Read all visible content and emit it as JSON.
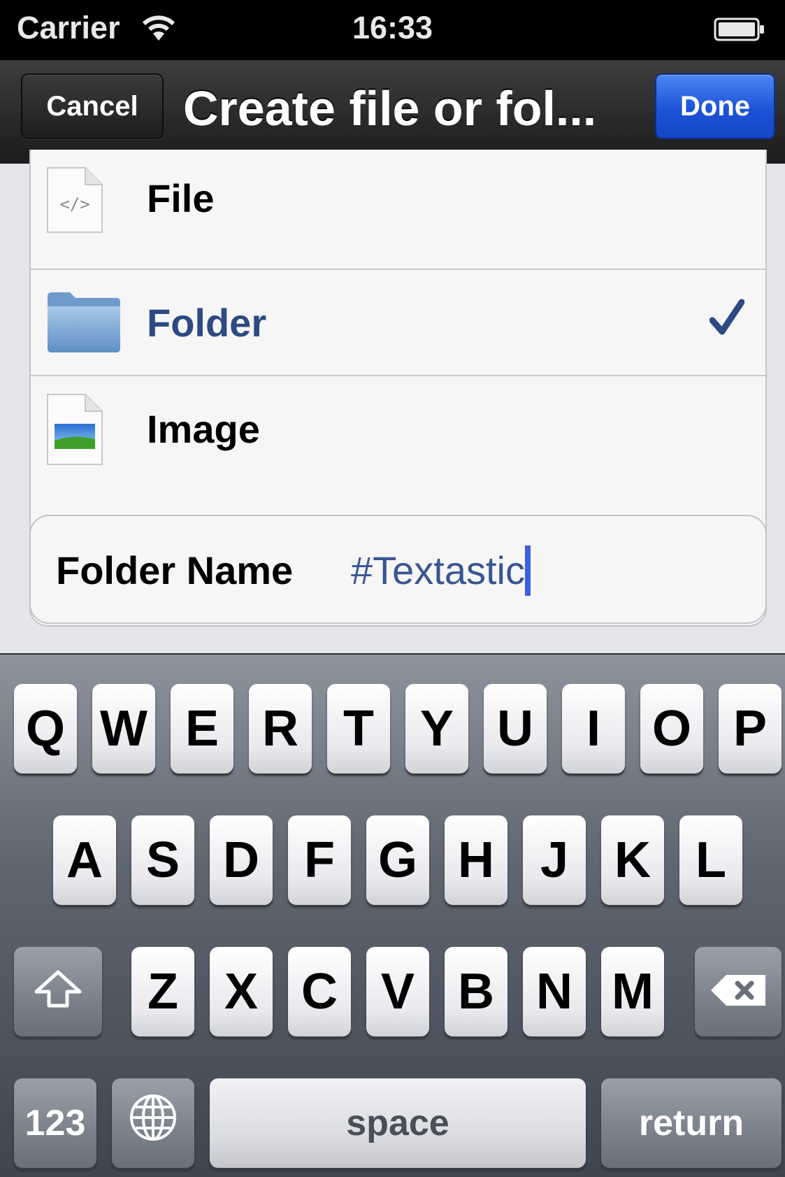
{
  "status_bar": {
    "carrier": "Carrier",
    "time": "16:33"
  },
  "nav_bar": {
    "cancel_label": "Cancel",
    "title": "Create file or fol...",
    "done_label": "Done"
  },
  "item_types": [
    {
      "label": "File",
      "icon": "code-file-icon",
      "selected": false
    },
    {
      "label": "Folder",
      "icon": "folder-icon",
      "selected": true
    },
    {
      "label": "Image",
      "icon": "image-file-icon",
      "selected": false
    }
  ],
  "name_field": {
    "label": "Folder Name",
    "value": "#Textastic"
  },
  "keyboard": {
    "row1": [
      "Q",
      "W",
      "E",
      "R",
      "T",
      "Y",
      "U",
      "I",
      "O",
      "P"
    ],
    "row2": [
      "A",
      "S",
      "D",
      "F",
      "G",
      "H",
      "J",
      "K",
      "L"
    ],
    "row3": [
      "Z",
      "X",
      "C",
      "V",
      "B",
      "N",
      "M"
    ],
    "numbers_label": "123",
    "space_label": "space",
    "return_label": "return"
  },
  "colors": {
    "accent_blue": "#1c53d9",
    "selected_text": "#2d4a82",
    "field_value": "#3a5592"
  }
}
